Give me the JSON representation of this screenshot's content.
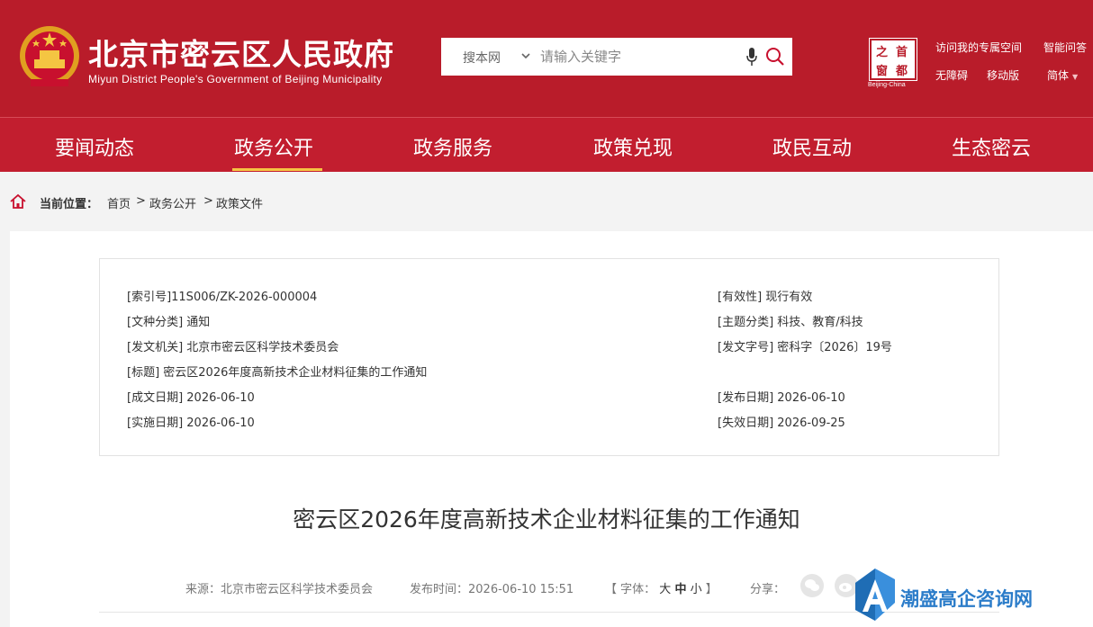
{
  "header": {
    "title": "北京市密云区人民政府",
    "subtitle": "Miyun District People's Government of Beijing Municipality",
    "search": {
      "scope": "搜本网",
      "placeholder": "请输入关键字"
    },
    "capital_logo": {
      "chars": [
        "首",
        "都",
        "之",
        "窗"
      ],
      "caption": "Beijing-China"
    },
    "links": {
      "personal_space": "访问我的专属空间",
      "smart_qa": "智能问答",
      "accessibility": "无障碍",
      "mobile": "移动版",
      "language": "简体"
    }
  },
  "nav": {
    "items": [
      "要闻动态",
      "政务公开",
      "政务服务",
      "政策兑现",
      "政民互动",
      "生态密云"
    ],
    "active": "政务公开"
  },
  "breadcrumb": {
    "label": "当前位置：",
    "items": [
      "首页",
      "政务公开",
      "政策文件"
    ],
    "separator": ">"
  },
  "meta": {
    "index_no": "[索引号]11S006/ZK-2026-000004",
    "validity": "[有效性] 现行有效",
    "doc_type": "[文种分类] 通知",
    "topic": "[主题分类] 科技、教育/科技",
    "issuer": "[发文机关] 北京市密云区科学技术委员会",
    "doc_no": "[发文字号] 密科字〔2026〕19号",
    "title": "[标题] 密云区2026年度高新技术企业材料征集的工作通知",
    "created": "[成文日期] 2026-06-10",
    "published": "[发布日期] 2026-06-10",
    "effective": "[实施日期] 2026-06-10",
    "expires": "[失效日期] 2026-09-25"
  },
  "article": {
    "title": "密云区2026年度高新技术企业材料征集的工作通知",
    "source": "来源：北京市密云区科学技术委员会",
    "publish_time": "发布时间：2026-06-10 15:51",
    "font_label": "【 字体：",
    "font_sizes": [
      "大",
      "中",
      "小"
    ],
    "font_end": "】",
    "share_label": "分享："
  },
  "watermark": {
    "text": "潮盛高企咨询网"
  },
  "colors": {
    "brand_red": "#b91c2a",
    "nav_red": "#c21e2f",
    "accent_gold": "#f5c443",
    "watermark_blue": "#2b7cc9"
  }
}
